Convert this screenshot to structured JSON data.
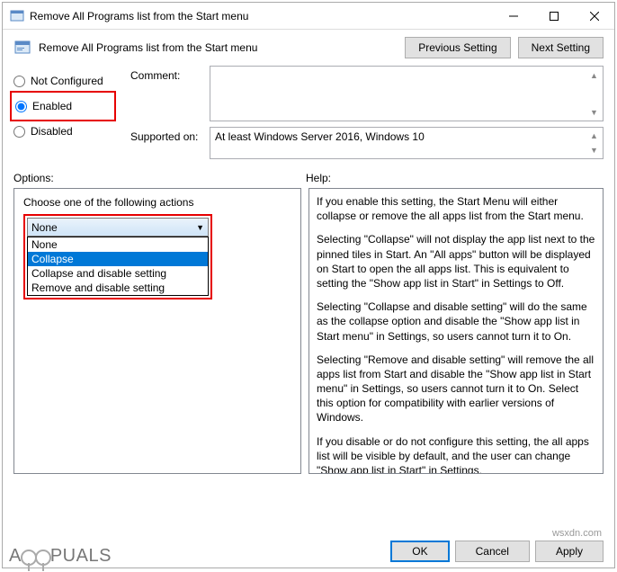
{
  "titlebar": {
    "text": "Remove All Programs list from the Start menu"
  },
  "header": {
    "title": "Remove All Programs list from the Start menu",
    "prev": "Previous Setting",
    "next": "Next Setting"
  },
  "state": {
    "not_configured": "Not Configured",
    "enabled": "Enabled",
    "disabled": "Disabled",
    "selected": "enabled"
  },
  "fields": {
    "comment_label": "Comment:",
    "comment_value": "",
    "supported_label": "Supported on:",
    "supported_value": "At least Windows Server 2016, Windows 10"
  },
  "labels": {
    "options": "Options:",
    "help": "Help:"
  },
  "options": {
    "choose_label": "Choose one of the following actions",
    "selected": "None",
    "items": [
      "None",
      "Collapse",
      "Collapse and disable setting",
      "Remove and disable setting"
    ],
    "highlighted": "Collapse"
  },
  "help": {
    "p1": "If you enable this setting, the Start Menu will either collapse or remove the all apps list from the Start menu.",
    "p2": "Selecting \"Collapse\" will not display the app list next to the pinned tiles in Start. An \"All apps\" button will be displayed on Start to open the all apps list. This is equivalent to setting the \"Show app list in Start\" in Settings to Off.",
    "p3": "Selecting \"Collapse and disable setting\" will do the same as the collapse option and disable the \"Show app list in Start menu\" in Settings, so users cannot turn it to On.",
    "p4": "Selecting \"Remove and disable setting\" will remove the all apps list from Start and disable the \"Show app list in Start menu\" in Settings, so users cannot turn it to On. Select this option for compatibility with earlier versions of Windows.",
    "p5": "If you disable or do not configure this setting, the all apps list will be visible by default, and the user can change \"Show app list in Start\" in Settings."
  },
  "buttons": {
    "ok": "OK",
    "cancel": "Cancel",
    "apply": "Apply"
  },
  "watermark": {
    "brand_a": "A",
    "brand_b": "PUALS",
    "site": "wsxdn.com"
  }
}
